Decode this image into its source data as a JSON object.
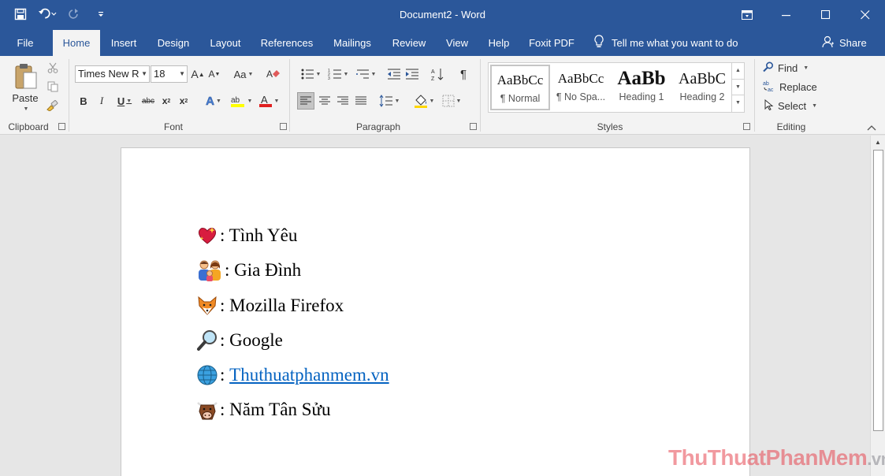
{
  "app": {
    "document_title": "Document2",
    "separator": "-",
    "app_name": "Word"
  },
  "colors": {
    "brand": "#2b579a",
    "ribbon_bg": "#f3f3f3",
    "link": "#0563c1",
    "watermark_red": "#e64650"
  },
  "quick_access": {
    "save_icon": "save-icon",
    "undo_icon": "undo-icon",
    "redo_icon": "redo-icon",
    "customize_icon": "customize-qat-icon"
  },
  "tabs": [
    {
      "label": "File"
    },
    {
      "label": "Home"
    },
    {
      "label": "Insert"
    },
    {
      "label": "Design"
    },
    {
      "label": "Layout"
    },
    {
      "label": "References"
    },
    {
      "label": "Mailings"
    },
    {
      "label": "Review"
    },
    {
      "label": "View"
    },
    {
      "label": "Help"
    },
    {
      "label": "Foxit PDF"
    }
  ],
  "active_tab": "Home",
  "tell_me": "Tell me what you want to do",
  "share_label": "Share",
  "ribbon": {
    "clipboard": {
      "label": "Clipboard",
      "paste_label": "Paste"
    },
    "font": {
      "label": "Font",
      "font_name": "Times New R",
      "font_size": "18"
    },
    "paragraph": {
      "label": "Paragraph"
    },
    "styles": {
      "label": "Styles",
      "items": [
        {
          "sample": "AaBbCc",
          "name": "¶ Normal"
        },
        {
          "sample": "AaBbCc",
          "name": "¶ No Spa..."
        },
        {
          "sample": "AaBb",
          "name": "Heading 1"
        },
        {
          "sample": "AaBbC",
          "name": "Heading 2"
        }
      ]
    },
    "editing": {
      "label": "Editing",
      "find": "Find",
      "replace": "Replace",
      "select": "Select"
    }
  },
  "document": {
    "lines": [
      {
        "emoji": "sparkling-heart-emoji",
        "sep": ":",
        "text": " Tình Yêu"
      },
      {
        "emoji": "family-emoji",
        "sep": ":",
        "text": " Gia Đình"
      },
      {
        "emoji": "fox-face-emoji",
        "sep": ":",
        "text": " Mozilla Firefox"
      },
      {
        "emoji": "magnifying-glass-emoji",
        "sep": ":",
        "text": " Google"
      },
      {
        "emoji": "globe-emoji",
        "sep": ": ",
        "text": "Thuthuatphanmem.vn"
      },
      {
        "emoji": "ox-face-emoji",
        "sep": ":",
        "text": " Năm Tân Sửu"
      }
    ]
  },
  "watermark": {
    "part1": "ThuThuatPhanMem",
    "part2": ".vn"
  }
}
